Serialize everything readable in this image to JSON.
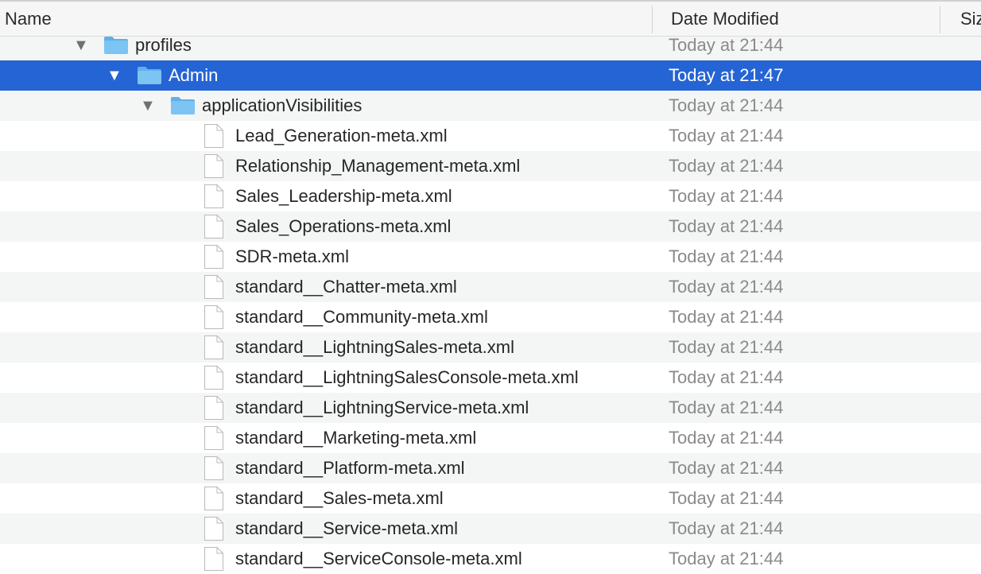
{
  "columns": {
    "name": "Name",
    "date_modified": "Date Modified",
    "size": "Siz"
  },
  "colors": {
    "selection": "#2564d4",
    "folder": "#7cc4f2",
    "alt_row": "#f4f5f5"
  },
  "rows": [
    {
      "label": "profiles",
      "date": "Today at 21:44",
      "kind": "folder",
      "expanded": true,
      "depth": 0,
      "icon": "folder-icon"
    },
    {
      "label": "Admin",
      "date": "Today at 21:47",
      "kind": "folder",
      "expanded": true,
      "depth": 1,
      "icon": "folder-icon",
      "selected": true
    },
    {
      "label": "applicationVisibilities",
      "date": "Today at 21:44",
      "kind": "folder",
      "expanded": true,
      "depth": 2,
      "icon": "folder-icon"
    },
    {
      "label": "Lead_Generation-meta.xml",
      "date": "Today at 21:44",
      "kind": "file",
      "depth": 3,
      "icon": "document-icon"
    },
    {
      "label": "Relationship_Management-meta.xml",
      "date": "Today at 21:44",
      "kind": "file",
      "depth": 3,
      "icon": "document-icon"
    },
    {
      "label": "Sales_Leadership-meta.xml",
      "date": "Today at 21:44",
      "kind": "file",
      "depth": 3,
      "icon": "document-icon"
    },
    {
      "label": "Sales_Operations-meta.xml",
      "date": "Today at 21:44",
      "kind": "file",
      "depth": 3,
      "icon": "document-icon"
    },
    {
      "label": "SDR-meta.xml",
      "date": "Today at 21:44",
      "kind": "file",
      "depth": 3,
      "icon": "document-icon"
    },
    {
      "label": "standard__Chatter-meta.xml",
      "date": "Today at 21:44",
      "kind": "file",
      "depth": 3,
      "icon": "document-icon"
    },
    {
      "label": "standard__Community-meta.xml",
      "date": "Today at 21:44",
      "kind": "file",
      "depth": 3,
      "icon": "document-icon"
    },
    {
      "label": "standard__LightningSales-meta.xml",
      "date": "Today at 21:44",
      "kind": "file",
      "depth": 3,
      "icon": "document-icon"
    },
    {
      "label": "standard__LightningSalesConsole-meta.xml",
      "date": "Today at 21:44",
      "kind": "file",
      "depth": 3,
      "icon": "document-icon"
    },
    {
      "label": "standard__LightningService-meta.xml",
      "date": "Today at 21:44",
      "kind": "file",
      "depth": 3,
      "icon": "document-icon"
    },
    {
      "label": "standard__Marketing-meta.xml",
      "date": "Today at 21:44",
      "kind": "file",
      "depth": 3,
      "icon": "document-icon"
    },
    {
      "label": "standard__Platform-meta.xml",
      "date": "Today at 21:44",
      "kind": "file",
      "depth": 3,
      "icon": "document-icon"
    },
    {
      "label": "standard__Sales-meta.xml",
      "date": "Today at 21:44",
      "kind": "file",
      "depth": 3,
      "icon": "document-icon"
    },
    {
      "label": "standard__Service-meta.xml",
      "date": "Today at 21:44",
      "kind": "file",
      "depth": 3,
      "icon": "document-icon"
    },
    {
      "label": "standard__ServiceConsole-meta.xml",
      "date": "Today at 21:44",
      "kind": "file",
      "depth": 3,
      "icon": "document-icon"
    }
  ]
}
